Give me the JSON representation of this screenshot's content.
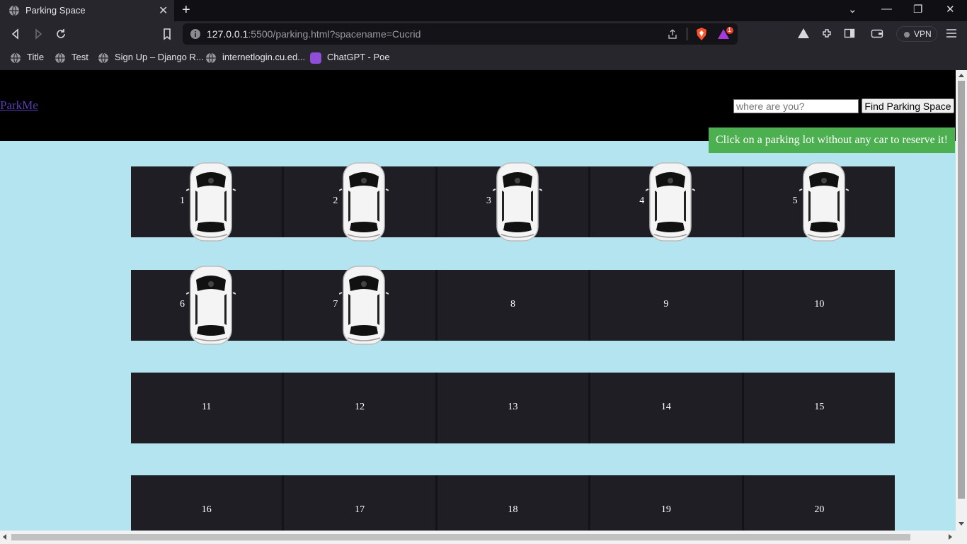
{
  "browser": {
    "tab_title": "Parking Space",
    "url_host": "127.0.0.1",
    "url_rest": ":5500/parking.html?spacename=Cucrid",
    "vpn_label": "VPN",
    "rewards_badge": "1",
    "bookmarks": [
      "Title",
      "Test",
      "Sign Up – Django R...",
      "internetlogin.cu.ed...",
      "ChatGPT - Poe"
    ]
  },
  "header": {
    "logo": "ParkMe",
    "search_placeholder": "where are you?",
    "find_button": "Find Parking Space"
  },
  "notice": "Click on a parking lot without any car to reserve it!",
  "parking": {
    "rows": [
      [
        {
          "n": "1",
          "occupied": true
        },
        {
          "n": "2",
          "occupied": true
        },
        {
          "n": "3",
          "occupied": true
        },
        {
          "n": "4",
          "occupied": true
        },
        {
          "n": "5",
          "occupied": true
        }
      ],
      [
        {
          "n": "6",
          "occupied": true
        },
        {
          "n": "7",
          "occupied": true
        },
        {
          "n": "8",
          "occupied": false
        },
        {
          "n": "9",
          "occupied": false
        },
        {
          "n": "10",
          "occupied": false
        }
      ],
      [
        {
          "n": "11",
          "occupied": false
        },
        {
          "n": "12",
          "occupied": false
        },
        {
          "n": "13",
          "occupied": false
        },
        {
          "n": "14",
          "occupied": false
        },
        {
          "n": "15",
          "occupied": false
        }
      ],
      [
        {
          "n": "16",
          "occupied": false
        },
        {
          "n": "17",
          "occupied": false
        },
        {
          "n": "18",
          "occupied": false
        },
        {
          "n": "19",
          "occupied": false
        },
        {
          "n": "20",
          "occupied": false
        }
      ]
    ]
  },
  "colors": {
    "page_bg": "#b3e4ef",
    "header_bg": "#000000",
    "lot_bg": "#1e1e24",
    "notice_bg": "#4caf50",
    "logo_link": "#5a3fb4"
  },
  "icons": [
    "globe-icon",
    "close-icon",
    "plus-icon",
    "back-icon",
    "forward-icon",
    "reload-icon",
    "bookmark-icon",
    "info-icon",
    "share-icon",
    "brave-shield-icon",
    "brave-rewards-icon",
    "leo-icon",
    "extensions-icon",
    "sidebar-icon",
    "wallet-icon",
    "menu-icon",
    "car-icon"
  ]
}
